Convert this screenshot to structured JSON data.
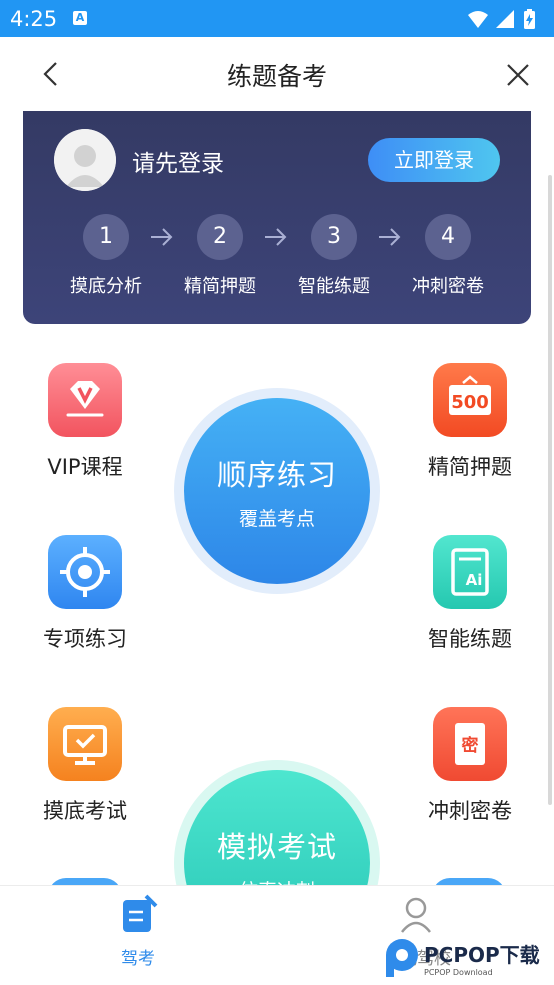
{
  "status_bar": {
    "time": "4:25",
    "notification_glyph": "A"
  },
  "header": {
    "title": "练题备考"
  },
  "login_card": {
    "prompt": "请先登录",
    "login_button": "立即登录",
    "steps": [
      {
        "number": "1",
        "label": "摸底分析"
      },
      {
        "number": "2",
        "label": "精简押题"
      },
      {
        "number": "3",
        "label": "智能练题"
      },
      {
        "number": "4",
        "label": "冲刺密卷"
      }
    ]
  },
  "grid": {
    "vip": {
      "label": "VIP课程",
      "icon": "diamond-v-icon"
    },
    "jingjian": {
      "label": "精简押题",
      "icon": "500-board-icon",
      "badge": "500"
    },
    "zhuanxiang": {
      "label": "专项练习",
      "icon": "target-icon"
    },
    "zhineng": {
      "label": "智能练题",
      "icon": "ai-document-icon",
      "badge": "Ai"
    },
    "modi": {
      "label": "摸底考试",
      "icon": "monitor-check-icon"
    },
    "chongci": {
      "label": "冲刺密卷",
      "icon": "secret-paper-icon",
      "badge": "密"
    }
  },
  "sequential_practice": {
    "title": "顺序练习",
    "subtitle": "覆盖考点"
  },
  "mock_exam": {
    "title": "模拟考试",
    "subtitle": "仿真冲刺"
  },
  "bottom_nav": {
    "tabs": [
      {
        "label": "驾考",
        "active": true
      },
      {
        "label": "找驾校",
        "active": false
      }
    ]
  },
  "watermark": {
    "text": "PCPOP下载",
    "subtext": "PCPOP Download"
  },
  "colors": {
    "status_bar": "#2196f3",
    "card_bg": "#363c6a",
    "accent_blue": "#2f8bea",
    "mint": "#3fdcc8"
  }
}
